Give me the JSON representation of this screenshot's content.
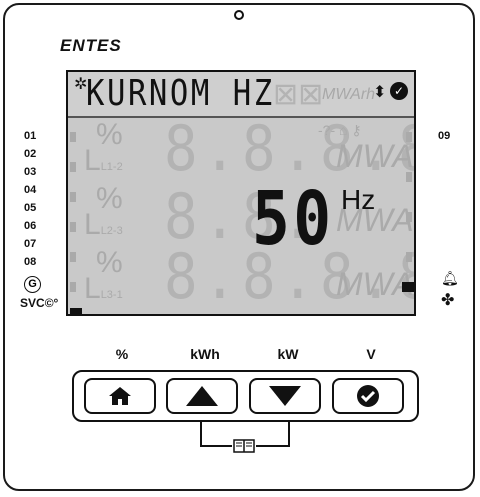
{
  "brand": "ENTES",
  "lcd": {
    "message": "KURNOM HZ",
    "value": "50",
    "value_unit": "Hz",
    "ghost_unit_top": "MWArh",
    "ghost_unit": "MWArh",
    "ghost_digits": "8.8.8.8",
    "ghost_pct": "%",
    "ghost_phase_rows": [
      "L1-2",
      "L2-3",
      "L3-1"
    ]
  },
  "channels_left": [
    "01",
    "02",
    "03",
    "04",
    "05",
    "06",
    "07",
    "08"
  ],
  "channel_right": "09",
  "badges": {
    "g": "G",
    "svc": "SVC"
  },
  "keys": [
    {
      "label": "%",
      "icon": "home-icon"
    },
    {
      "label": "kWh",
      "icon": "up-arrow-icon"
    },
    {
      "label": "kW",
      "icon": "down-arrow-icon"
    },
    {
      "label": "V",
      "icon": "check-icon"
    }
  ],
  "colors": {
    "lcd_bg": "#c9c9c9",
    "segment_off": "#b3b3b3",
    "ink": "#111111"
  }
}
